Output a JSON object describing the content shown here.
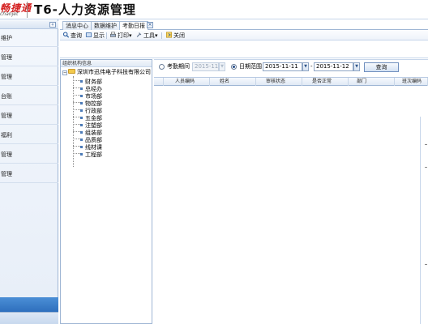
{
  "header": {
    "logo_text": "畅捷通",
    "logo_sub": "chanjet",
    "app_title": "T6-人力资源管理"
  },
  "sidebar": {
    "items": [
      {
        "label": "维护"
      },
      {
        "label": "管理"
      },
      {
        "label": "管理"
      },
      {
        "label": "台账"
      },
      {
        "label": "管理"
      },
      {
        "label": "福利"
      },
      {
        "label": "管理"
      },
      {
        "label": "管理"
      }
    ]
  },
  "tabs": [
    {
      "label": "消息中心"
    },
    {
      "label": "数据维护"
    },
    {
      "label": "考勤日报"
    }
  ],
  "toolbar": {
    "query": "查询",
    "show": "显示",
    "print": "打印",
    "tools": "工具",
    "close": "关闭"
  },
  "tree": {
    "header": "组织机构信息",
    "root": "深圳市迅伟电子科技有限公司",
    "nodes": [
      "财务部",
      "总经办",
      "市场部",
      "物控部",
      "行政部",
      "五金部",
      "注塑部",
      "组装部",
      "品质部",
      "线材课",
      "工程部"
    ]
  },
  "filter": {
    "period_label": "考勤期间",
    "period_value": "2015-11",
    "range_label": "日期范围",
    "date_from": "2015-11-11",
    "separator": "-",
    "date_to": "2015-11-12",
    "query_button": "查询"
  },
  "grid": {
    "columns": [
      "人员编码",
      "姓名",
      "审核状态",
      "是否正常",
      "部门",
      "班次编码"
    ]
  }
}
